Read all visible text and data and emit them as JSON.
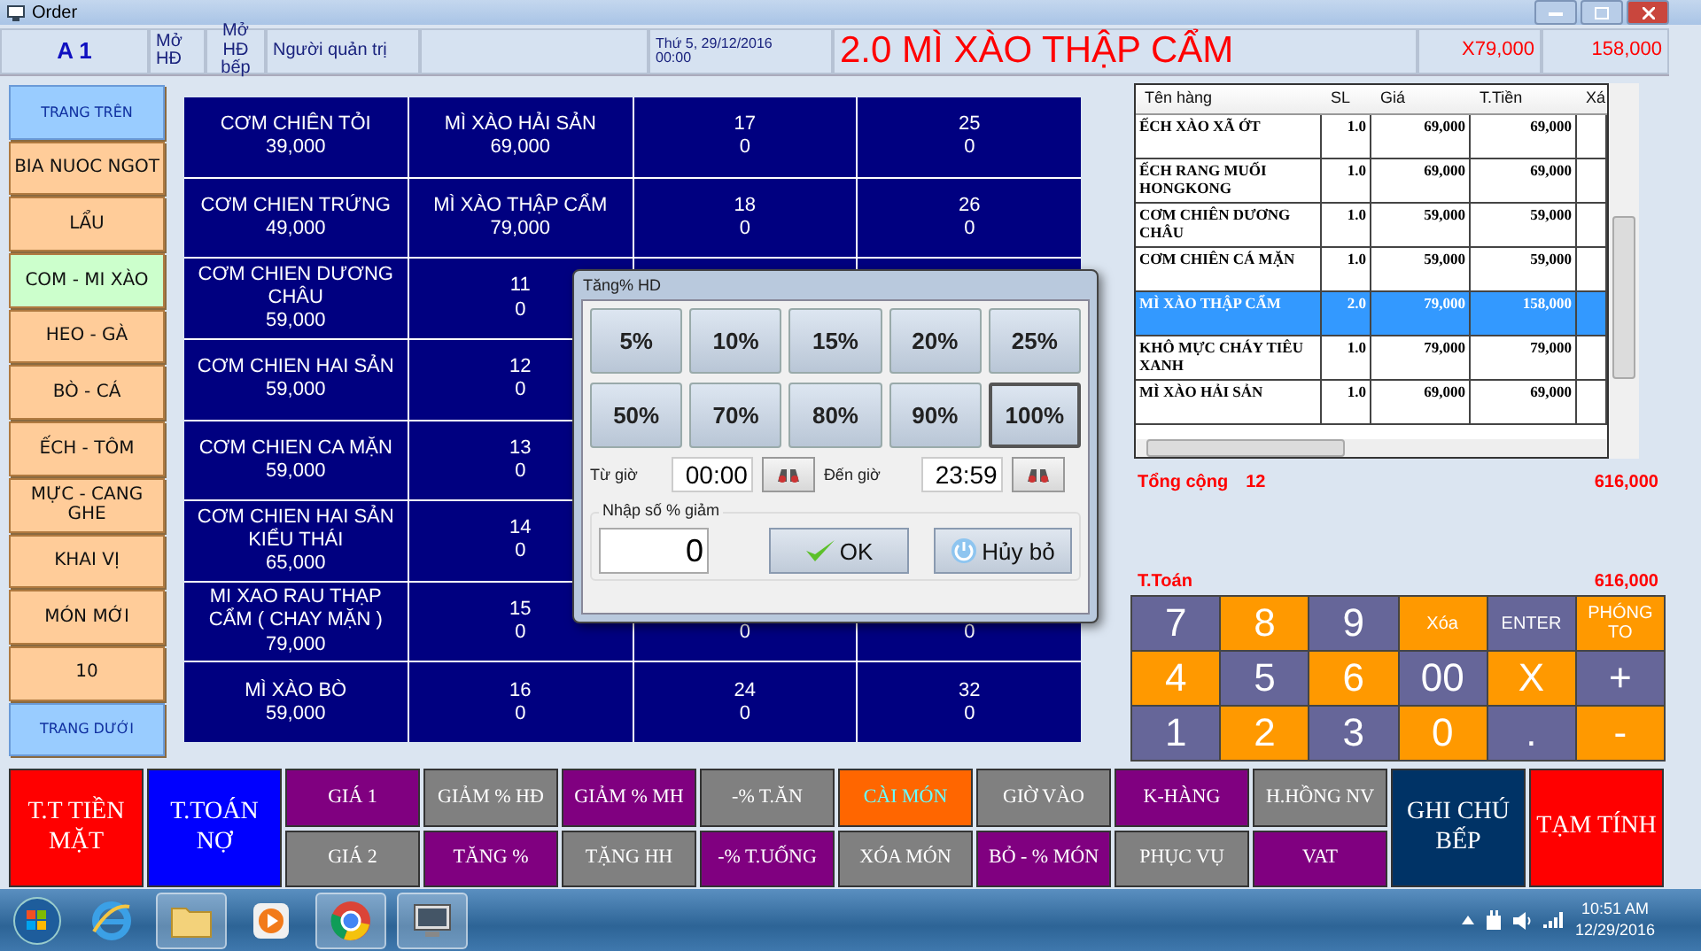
{
  "window": {
    "title": "Order"
  },
  "header": {
    "table": "A 1",
    "open_bill": "Mở HĐ",
    "open_kitchen": "Mở HĐ bếp",
    "user": "Người quản trị",
    "date": "Thứ 5, 29/12/2016",
    "time": "00:00",
    "current_item": "2.0 MÌ XÀO THẬP CẨM",
    "unit_price": "X79,000",
    "amount": "158,000"
  },
  "categories": [
    {
      "label": "TRANG TRÊN",
      "kind": "page"
    },
    {
      "label": "BIA NUOC NGOT",
      "kind": "group",
      "selected": false
    },
    {
      "label": "LẨU",
      "kind": "group",
      "selected": false
    },
    {
      "label": "COM - MI XÀO",
      "kind": "group",
      "selected": true
    },
    {
      "label": "HEO - GÀ",
      "kind": "group",
      "selected": false
    },
    {
      "label": "BÒ - CÁ",
      "kind": "group",
      "selected": false
    },
    {
      "label": "ẾCH - TÔM",
      "kind": "group",
      "selected": false
    },
    {
      "label": "MỰC - CANG GHE",
      "kind": "group",
      "selected": false
    },
    {
      "label": "KHAI VỊ",
      "kind": "group",
      "selected": false
    },
    {
      "label": "MÓN MỚI",
      "kind": "group",
      "selected": false
    },
    {
      "label": "10",
      "kind": "group",
      "selected": false
    },
    {
      "label": "TRANG DƯỚI",
      "kind": "page"
    }
  ],
  "menu_grid": [
    [
      {
        "name": "CƠM CHIÊN TỎI",
        "price": "39,000"
      },
      {
        "name": "MÌ XÀO HẢI SẢN",
        "price": "69,000"
      },
      {
        "name": "17",
        "price": "0"
      },
      {
        "name": "25",
        "price": "0"
      }
    ],
    [
      {
        "name": "CƠM CHIEN TRỨNG",
        "price": "49,000"
      },
      {
        "name": "MÌ XÀO THẬP CẨM",
        "price": "79,000"
      },
      {
        "name": "18",
        "price": "0"
      },
      {
        "name": "26",
        "price": "0"
      }
    ],
    [
      {
        "name": "CƠM CHIEN DƯƠNG CHÂU",
        "price": "59,000"
      },
      {
        "name": "11",
        "price": "0"
      }
    ],
    [
      {
        "name": "CƠM CHIEN HAI SẢN",
        "price": "59,000"
      },
      {
        "name": "12",
        "price": "0"
      }
    ],
    [
      {
        "name": "CƠM CHIEN CA MẶN",
        "price": "59,000"
      },
      {
        "name": "13",
        "price": "0"
      }
    ],
    [
      {
        "name": "CƠM CHIEN HAI SẢN KIỂU THÁI",
        "price": "65,000"
      },
      {
        "name": "14",
        "price": "0"
      }
    ],
    [
      {
        "name": "MI XAO RAU THẠP CẨM ( CHAY MẶN )",
        "price": "79,000"
      },
      {
        "name": "15",
        "price": "0"
      },
      {
        "price": "0"
      },
      {
        "price": "0"
      }
    ],
    [
      {
        "name": "MÌ XÀO BÒ",
        "price": "59,000"
      },
      {
        "name": "16",
        "price": "0"
      },
      {
        "name": "24",
        "price": "0"
      },
      {
        "name": "32",
        "price": "0"
      }
    ]
  ],
  "dialog": {
    "title": "Tăng% HD",
    "percent_buttons": [
      {
        "label": "5%",
        "selected": false
      },
      {
        "label": "10%",
        "selected": false
      },
      {
        "label": "15%",
        "selected": false
      },
      {
        "label": "20%",
        "selected": false
      },
      {
        "label": "25%",
        "selected": false
      },
      {
        "label": "50%",
        "selected": false
      },
      {
        "label": "70%",
        "selected": false
      },
      {
        "label": "80%",
        "selected": false
      },
      {
        "label": "90%",
        "selected": false
      },
      {
        "label": "100%",
        "selected": true
      }
    ],
    "from_label": "Từ giờ",
    "from_value": "00:00",
    "to_label": "Đến giờ",
    "to_value": "23:59",
    "percent_group": "Nhập số % giảm",
    "percent_value": "0",
    "ok": "OK",
    "cancel": "Hủy bỏ"
  },
  "order": {
    "columns": [
      "Tên hàng",
      "SL",
      "Giá",
      "T.Tiền",
      "Xá"
    ],
    "rows": [
      {
        "name": "ẾCH XÀO XÃ ỚT",
        "qty": "1.0",
        "price": "69,000",
        "total": "69,000",
        "selected": false
      },
      {
        "name": "ẾCH RANG MUỐI HONGKONG",
        "qty": "1.0",
        "price": "69,000",
        "total": "69,000",
        "selected": false
      },
      {
        "name": "CƠM CHIÊN DƯƠNG CHÂU",
        "qty": "1.0",
        "price": "59,000",
        "total": "59,000",
        "selected": false
      },
      {
        "name": "CƠM CHIÊN CÁ MẶN",
        "qty": "1.0",
        "price": "59,000",
        "total": "59,000",
        "selected": false
      },
      {
        "name": "MÌ XÀO THẬP CẨM",
        "qty": "2.0",
        "price": "79,000",
        "total": "158,000",
        "selected": true
      },
      {
        "name": "KHÔ MỰC CHÁY TIÊU XANH",
        "qty": "1.0",
        "price": "79,000",
        "total": "79,000",
        "selected": false
      },
      {
        "name": "MÌ XÀO HẢI SẢN",
        "qty": "1.0",
        "price": "69,000",
        "total": "69,000",
        "selected": false
      }
    ],
    "total_label": "Tổng cộng",
    "total_count": "12",
    "total_amount": "616,000",
    "pay_label": "T.Toán",
    "pay_amount": "616,000"
  },
  "keypad": [
    {
      "label": "7",
      "kind": "big",
      "color": "#666699"
    },
    {
      "label": "8",
      "kind": "big",
      "color": "#ff9900"
    },
    {
      "label": "9",
      "kind": "big",
      "color": "#666699"
    },
    {
      "label": "Xóa",
      "kind": "small",
      "color": "#ff9900"
    },
    {
      "label": "ENTER",
      "kind": "small",
      "color": "#666699"
    },
    {
      "label": "PHÓNG TO",
      "kind": "small",
      "color": "#ff9900"
    },
    {
      "label": "4",
      "kind": "big",
      "color": "#ff9900"
    },
    {
      "label": "5",
      "kind": "big",
      "color": "#666699"
    },
    {
      "label": "6",
      "kind": "big",
      "color": "#ff9900"
    },
    {
      "label": "00",
      "kind": "big",
      "color": "#666699"
    },
    {
      "label": "X",
      "kind": "big",
      "color": "#ff9900"
    },
    {
      "label": "+",
      "kind": "big",
      "color": "#666699"
    },
    {
      "label": "1",
      "kind": "big",
      "color": "#666699"
    },
    {
      "label": "2",
      "kind": "big",
      "color": "#ff9900"
    },
    {
      "label": "3",
      "kind": "big",
      "color": "#666699"
    },
    {
      "label": "0",
      "kind": "big",
      "color": "#ff9900"
    },
    {
      "label": ".",
      "kind": "big",
      "color": "#666699"
    },
    {
      "label": "-",
      "kind": "big",
      "color": "#ff9900"
    }
  ],
  "actions": [
    {
      "kind": "large",
      "label": "T.T TIỀN MẶT",
      "color": "#ff0000"
    },
    {
      "kind": "large",
      "label": "T.TOÁN NỢ",
      "color": "#0000ff"
    },
    {
      "kind": "pair",
      "top": {
        "label": "GIÁ 1",
        "color": "#800080"
      },
      "bottom": {
        "label": "GIÁ 2",
        "color": "#808080"
      }
    },
    {
      "kind": "pair",
      "top": {
        "label": "GIẢM % HĐ",
        "color": "#808080"
      },
      "bottom": {
        "label": "TĂNG %",
        "color": "#800080"
      }
    },
    {
      "kind": "pair",
      "top": {
        "label": "GIẢM % MH",
        "color": "#800080"
      },
      "bottom": {
        "label": "TẶNG HH",
        "color": "#808080"
      }
    },
    {
      "kind": "pair",
      "top": {
        "label": "-% T.ĂN",
        "color": "#808080"
      },
      "bottom": {
        "label": "-% T.UỐNG",
        "color": "#800080"
      }
    },
    {
      "kind": "pair",
      "top": {
        "label": "CÀI MÓN",
        "color": "#ff6600",
        "accent": true
      },
      "bottom": {
        "label": "XÓA MÓN",
        "color": "#808080"
      }
    },
    {
      "kind": "pair",
      "top": {
        "label": "GIỜ VÀO",
        "color": "#808080"
      },
      "bottom": {
        "label": "BỎ - % MÓN",
        "color": "#800080"
      }
    },
    {
      "kind": "pair",
      "top": {
        "label": "K-HÀNG",
        "color": "#800080"
      },
      "bottom": {
        "label": "PHỤC VỤ",
        "color": "#808080"
      }
    },
    {
      "kind": "pair",
      "top": {
        "label": "H.HỒNG NV",
        "color": "#808080"
      },
      "bottom": {
        "label": "VAT",
        "color": "#800080"
      }
    },
    {
      "kind": "large",
      "label": "GHI CHÚ BẾP",
      "color": "#003366"
    },
    {
      "kind": "large",
      "label": "TẠM TÍNH",
      "color": "#ff0000"
    }
  ],
  "taskbar": {
    "time": "10:51 AM",
    "date": "12/29/2016"
  }
}
